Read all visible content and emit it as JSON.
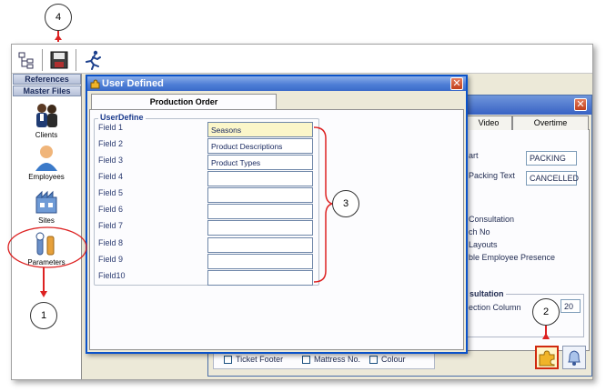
{
  "nav": {
    "headers": [
      "References",
      "Master Files"
    ],
    "items": [
      {
        "label": "Clients",
        "icon": "clients-icon"
      },
      {
        "label": "Employees",
        "icon": "employees-icon"
      },
      {
        "label": "Sites",
        "icon": "sites-icon"
      },
      {
        "label": "Parameters",
        "icon": "parameters-icon"
      }
    ]
  },
  "background_window": {
    "tabs": [
      "Video",
      "Overtime"
    ],
    "lines": [
      "art",
      "Packing Text",
      "Consultation",
      "ch No",
      "Layouts",
      "ble Employee Presence"
    ],
    "fields": {
      "packing": "PACKING",
      "cancelled": "CANCELLED",
      "col": "20"
    },
    "group_title": "sultation",
    "group_line": "ection Column",
    "checkboxes": [
      "Ticket Footer",
      "Mattress No.",
      "Colour"
    ]
  },
  "dialog": {
    "title": "User Defined",
    "tab": "Production Order",
    "group": "UserDefine",
    "fields": [
      {
        "label": "Field 1",
        "value": "Seasons"
      },
      {
        "label": "Field 2",
        "value": "Product Descriptions"
      },
      {
        "label": "Field 3",
        "value": "Product Types"
      },
      {
        "label": "Field 4",
        "value": ""
      },
      {
        "label": "Field 5",
        "value": ""
      },
      {
        "label": "Field 6",
        "value": ""
      },
      {
        "label": "Field 7",
        "value": ""
      },
      {
        "label": "Field 8",
        "value": ""
      },
      {
        "label": "Field 9",
        "value": ""
      },
      {
        "label": "Field10",
        "value": ""
      }
    ]
  },
  "callouts": [
    "1",
    "2",
    "3",
    "4"
  ],
  "colors": {
    "title_blue": "#3a6bc9",
    "annotation_red": "#dd2222",
    "highlight_field": "#fbf6c9"
  }
}
